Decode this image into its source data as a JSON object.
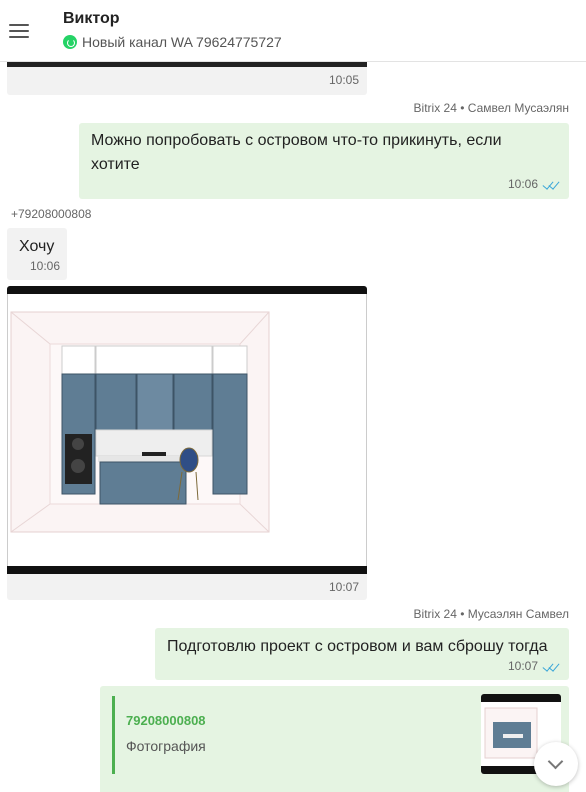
{
  "header": {
    "contact_name": "Виктор",
    "channel": "Новый канал WA 79624775727",
    "channel_icon": "whatsapp-icon"
  },
  "messages": {
    "m1": {
      "time": "10:05"
    },
    "m2": {
      "sender": "Bitrix 24 • Самвел Мусаэлян",
      "text": "Можно попробовать с островом что-то прикинуть, если хотите",
      "time": "10:06",
      "status": "read"
    },
    "m3": {
      "sender": "+79208000808",
      "text": "Хочу",
      "time": "10:06"
    },
    "m4": {
      "time": "10:07"
    },
    "m5": {
      "sender": "Bitrix 24 • Мусаэлян Самвел",
      "text": "Подготовлю проект с островом и вам сброшу тогда",
      "time": "10:07",
      "status": "read"
    },
    "m6": {
      "quote_author": "79208000808",
      "quote_text": "Фотография"
    }
  },
  "colors": {
    "incoming_bubble": "#f2f2f2",
    "outgoing_bubble": "#e5f4e2",
    "accent_green": "#4caf50",
    "read_check": "#3aa6d8"
  }
}
